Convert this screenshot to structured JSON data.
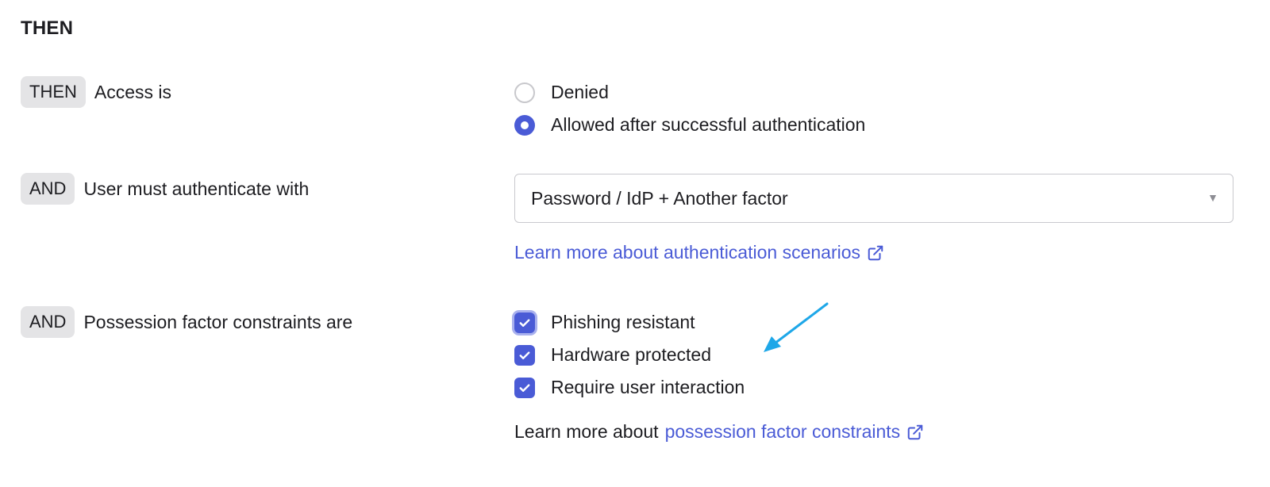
{
  "section": {
    "title": "THEN"
  },
  "access_row": {
    "pill": "THEN",
    "label": "Access is",
    "options": [
      {
        "label": "Denied",
        "selected": false
      },
      {
        "label": "Allowed after successful authentication",
        "selected": true
      }
    ]
  },
  "auth_row": {
    "pill": "AND",
    "label": "User must authenticate with",
    "select_value": "Password / IdP + Another factor",
    "learn_link": "Learn more about authentication scenarios"
  },
  "possession_row": {
    "pill": "AND",
    "label": "Possession factor constraints are",
    "options": [
      {
        "label": "Phishing resistant",
        "checked": true
      },
      {
        "label": "Hardware protected",
        "checked": true
      },
      {
        "label": "Require user interaction",
        "checked": true
      }
    ],
    "learn_prefix": "Learn more about",
    "learn_link": "possession factor constraints"
  },
  "colors": {
    "accent": "#4a5bd6",
    "pill_bg": "#e4e4e6",
    "annotation_arrow": "#1ea7e8"
  },
  "icons": {
    "external_link": "external-link-icon",
    "dropdown": "chevron-down-icon",
    "checkmark": "check-icon"
  }
}
